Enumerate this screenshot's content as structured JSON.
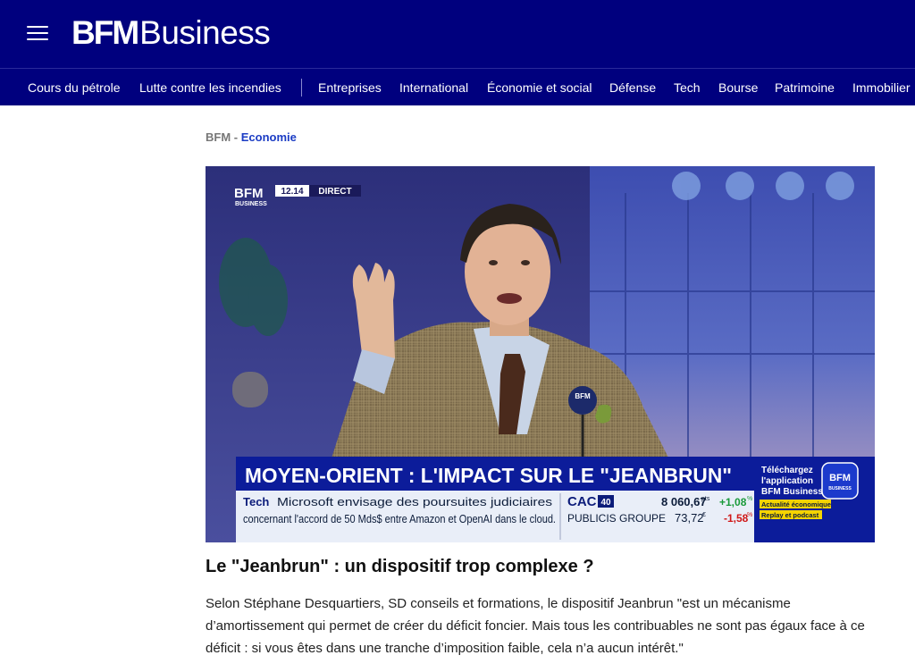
{
  "header": {
    "logo_bold": "BFM",
    "logo_light": "Business",
    "menu_icon": "hamburger-menu-icon"
  },
  "nav": {
    "items": [
      "Cours du pétrole",
      "Lutte contre les incendies",
      "Entreprises",
      "International",
      "Économie et social",
      "Défense",
      "Tech",
      "Bourse",
      "Patrimoine",
      "Immobilier"
    ]
  },
  "breadcrumb": {
    "home": "BFM",
    "separator": "-",
    "category": "Economie"
  },
  "hero": {
    "bug_logo": "BFM",
    "bug_sub": "BUSINESS",
    "time": "12.14",
    "live": "DIRECT",
    "mic_flag": "BFM",
    "banner": "MOYEN-ORIENT : L'IMPACT SUR LE \"JEANBRUN\"",
    "ticker_tag": "Tech",
    "ticker_line1": "Microsoft envisage des poursuites judiciaires",
    "ticker_line2": "concernant l'accord de 50 Mds$ entre Amazon et OpenAI dans le cloud.",
    "index_name": "CAC",
    "index_num": "40",
    "index_value": "8 060,67",
    "index_unit": "pts",
    "index_change": "+1,08",
    "stock_name": "PUBLICIS GROUPE",
    "stock_value": "73,72",
    "stock_unit": "€",
    "stock_change": "-1,58",
    "pct": "%",
    "promo_line1": "Téléchargez",
    "promo_line2": "l'application",
    "promo_line3": "BFM Business",
    "promo_logo": "BFM",
    "promo_logo_sub": "BUSINESS",
    "promo_tag1": "Actualité économique",
    "promo_tag2": "Replay et podcast"
  },
  "article": {
    "headline": "Le \"Jeanbrun\" : un dispositif trop complexe ?",
    "paragraph": "Selon Stéphane Desquartiers, SD conseils et formations, le dispositif Jeanbrun \"est un mécanisme d’amortissement qui permet de créer du déficit foncier. Mais tous les contribuables ne sont pas égaux face à ce déficit : si vous êtes dans une tranche d’imposition faible, cela n’a aucun intérêt.\""
  },
  "colors": {
    "brand_navy": "#00007e",
    "link_blue": "#1b3cc4",
    "ticker_green": "#1a9a3a",
    "ticker_red": "#d01818",
    "promo_yellow": "#f5d400"
  }
}
